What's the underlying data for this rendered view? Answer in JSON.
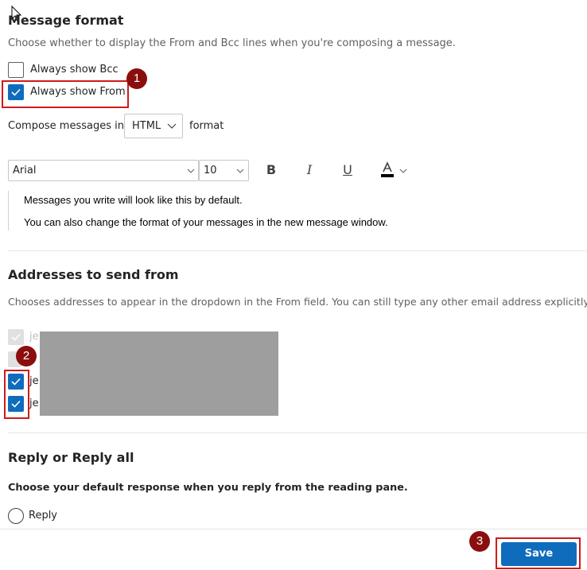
{
  "message_format": {
    "heading": "Message format",
    "description": "Choose whether to display the From and Bcc lines when you're composing a message.",
    "always_show_bcc": {
      "label": "Always show Bcc",
      "checked": false
    },
    "always_show_from": {
      "label": "Always show From",
      "checked": true
    },
    "compose_prefix": "Compose messages in",
    "compose_format_value": "HTML",
    "compose_suffix": "format",
    "font_family_value": "Arial",
    "font_size_value": "10",
    "toolbar_icons": [
      "bold-icon",
      "italic-icon",
      "underline-icon",
      "font-color-icon"
    ],
    "toolbar_glyphs": {
      "bold": "B",
      "italic": "I",
      "underline": "U"
    },
    "preview_line1": "Messages you write will look like this by default.",
    "preview_line2": "You can also change the format of your messages in the new message window."
  },
  "addresses": {
    "heading": "Addresses to send from",
    "description": "Chooses addresses to appear in the dropdown in the From field. You can still type any other email address explicitly",
    "items": [
      {
        "prefix": "je",
        "checked": true,
        "disabled": true
      },
      {
        "prefix": "",
        "checked": false,
        "disabled": true
      },
      {
        "prefix": "je",
        "checked": true,
        "disabled": false
      },
      {
        "prefix": "je",
        "checked": true,
        "disabled": false
      }
    ]
  },
  "reply": {
    "heading": "Reply or Reply all",
    "description": "Choose your default response when you reply from the reading pane.",
    "option_reply": "Reply"
  },
  "footer": {
    "save_label": "Save"
  },
  "annotations": {
    "badge1": "1",
    "badge2": "2",
    "badge3": "3"
  },
  "colors": {
    "accent": "#0f6cbd",
    "annotation_red": "#d11a1a",
    "badge_fill": "#8b0e0e",
    "redaction_gray": "#9e9e9e"
  }
}
